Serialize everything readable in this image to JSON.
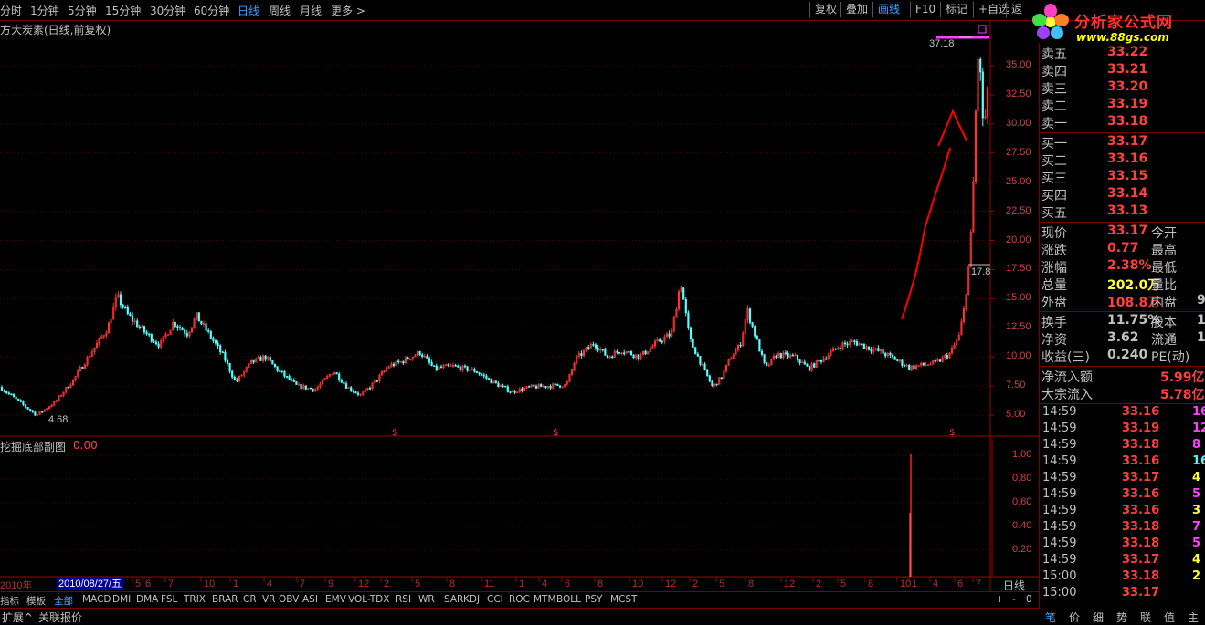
{
  "toolbar": {
    "periods": [
      "分时",
      "1分钟",
      "5分钟",
      "15分钟",
      "30分钟",
      "60分钟",
      "日线",
      "周线",
      "月线",
      "更多 >"
    ],
    "active_period": "日线",
    "buttons": [
      "复权",
      "叠加",
      "画线",
      "F10",
      "标记",
      "+自选",
      "返"
    ]
  },
  "logo": {
    "text": "分析家公式网",
    "url": "www.88gs.com"
  },
  "chart": {
    "title": "方大炭素(日线,前复权)",
    "high_label": "37.18",
    "low_label": "4.68",
    "mark_label": "17.8",
    "y_ticks": [
      "35.00",
      "32.50",
      "30.00",
      "27.50",
      "25.00",
      "22.50",
      "20.00",
      "17.50",
      "15.00",
      "12.50",
      "10.00",
      "7.50",
      "5.00"
    ],
    "colors": {
      "up": "#ff3232",
      "down": "#54ffff",
      "grid": "#7a0000",
      "annotation": "#ff0000"
    }
  },
  "subchart": {
    "title": "挖掘底部副图",
    "value": "0.00",
    "y_ticks": [
      "1.00",
      "0.80",
      "0.60",
      "0.40",
      "0.20"
    ]
  },
  "x_axis": {
    "year_label": "2010年",
    "date_box": "2010/08/27/五",
    "months": [
      "5",
      "6",
      "7",
      "10",
      "1",
      "4",
      "7",
      "9",
      "12",
      "2",
      "5",
      "8",
      "11",
      "1",
      "4",
      "6",
      "8",
      "10",
      "12",
      "2",
      "5",
      "8",
      "12",
      "2",
      "5",
      "8",
      "10",
      "1",
      "4",
      "6",
      "7"
    ],
    "period_label": "日线"
  },
  "indicators": [
    "指标",
    "模板",
    "全部",
    "MACD",
    "DMI",
    "DMA",
    "FSL",
    "TRIX",
    "BRAR",
    "CR",
    "VR",
    "OBV",
    "ASI",
    "EMV",
    "VOL-TDX",
    "RSI",
    "WR",
    "SAR",
    "KDJ",
    "CCI",
    "ROC",
    "MTM",
    "BOLL",
    "PSY",
    "MCST"
  ],
  "indicator_controls": [
    "+",
    "-",
    "0"
  ],
  "bottom": {
    "expand": "扩展^",
    "related": "关联报价"
  },
  "orderbook": {
    "asks": [
      {
        "label": "卖五",
        "price": "33.22"
      },
      {
        "label": "卖四",
        "price": "33.21"
      },
      {
        "label": "卖三",
        "price": "33.20"
      },
      {
        "label": "卖二",
        "price": "33.19"
      },
      {
        "label": "卖一",
        "price": "33.18"
      }
    ],
    "bids": [
      {
        "label": "买一",
        "price": "33.17"
      },
      {
        "label": "买二",
        "price": "33.16"
      },
      {
        "label": "买三",
        "price": "33.15"
      },
      {
        "label": "买四",
        "price": "33.14"
      },
      {
        "label": "买五",
        "price": "33.13"
      }
    ]
  },
  "quote": [
    {
      "l": "现价",
      "v": "33.17",
      "l2": "今开",
      "v2": "",
      "vc": "#ff4040"
    },
    {
      "l": "涨跌",
      "v": "0.77",
      "l2": "最高",
      "v2": "",
      "vc": "#ff4040"
    },
    {
      "l": "涨幅",
      "v": "2.38%",
      "l2": "最低",
      "v2": "",
      "vc": "#ff4040"
    },
    {
      "l": "总量",
      "v": "202.0万",
      "l2": "量比",
      "v2": "",
      "vc": "#ffff40"
    },
    {
      "l": "外盘",
      "v": "108.8万",
      "l2": "内盘",
      "v2": "9",
      "vc": "#ff4040"
    }
  ],
  "fundamentals": [
    {
      "l": "换手",
      "v": "11.75%",
      "l2": "股本",
      "v2": "1"
    },
    {
      "l": "净资",
      "v": "3.62",
      "l2": "流通",
      "v2": "1"
    },
    {
      "l": "收益(三)",
      "v": "0.240",
      "l2": "PE(动)",
      "v2": ""
    }
  ],
  "flows": [
    {
      "l": "净流入额",
      "v": "5.99亿"
    },
    {
      "l": "大宗流入",
      "v": "5.78亿"
    }
  ],
  "ticks": [
    {
      "t": "14:59",
      "p": "33.16",
      "v": "16",
      "c": "#ff40ff"
    },
    {
      "t": "14:59",
      "p": "33.19",
      "v": "12",
      "c": "#ff40ff"
    },
    {
      "t": "14:59",
      "p": "33.18",
      "v": "8",
      "c": "#ff40ff"
    },
    {
      "t": "14:59",
      "p": "33.16",
      "v": "16",
      "c": "#40ffff"
    },
    {
      "t": "14:59",
      "p": "33.17",
      "v": "4",
      "c": "#ffff40"
    },
    {
      "t": "14:59",
      "p": "33.16",
      "v": "5",
      "c": "#ff40ff"
    },
    {
      "t": "14:59",
      "p": "33.16",
      "v": "3",
      "c": "#ffff40"
    },
    {
      "t": "14:59",
      "p": "33.18",
      "v": "7",
      "c": "#ff40ff"
    },
    {
      "t": "14:59",
      "p": "33.18",
      "v": "5",
      "c": "#ff40ff"
    },
    {
      "t": "14:59",
      "p": "33.17",
      "v": "4",
      "c": "#ffff40"
    },
    {
      "t": "15:00",
      "p": "33.18",
      "v": "2",
      "c": "#ffff40"
    },
    {
      "t": "15:00",
      "p": "33.17",
      "v": "",
      "c": "#ffff40"
    }
  ],
  "right_tabs": [
    "笔",
    "价",
    "细",
    "势",
    "联",
    "值",
    "主"
  ]
}
